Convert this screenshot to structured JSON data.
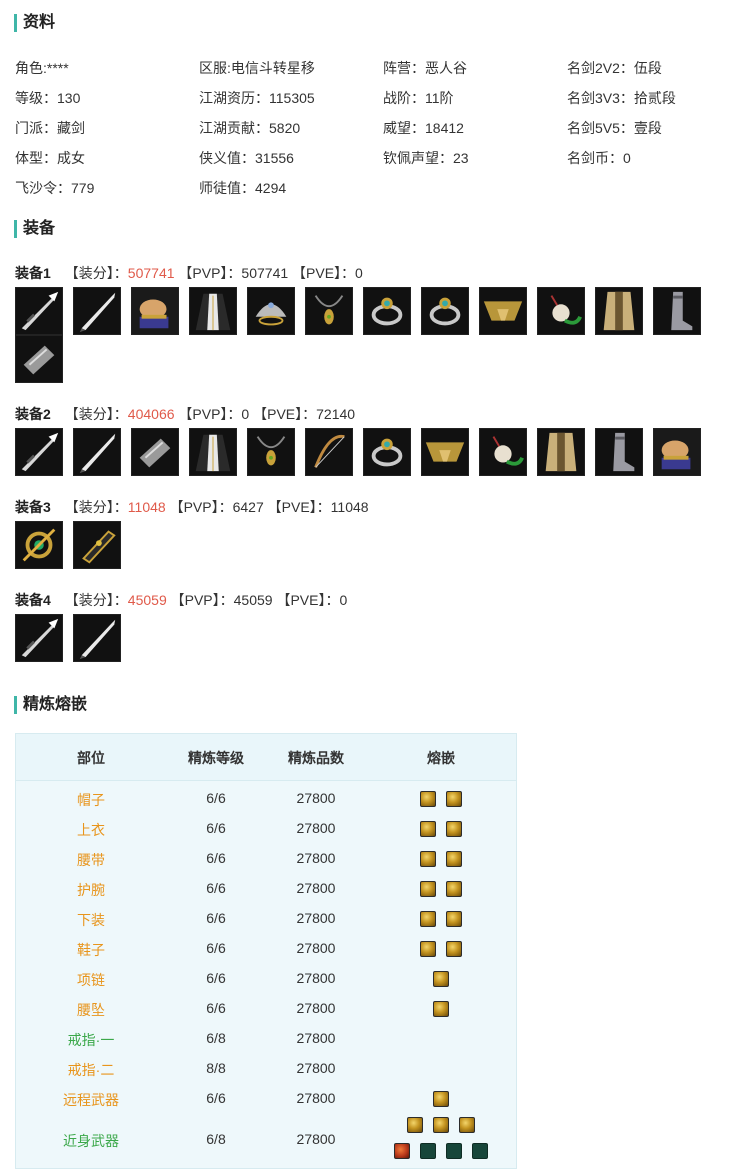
{
  "sections": {
    "profile": "资料",
    "equipment": "装备",
    "refine": "精炼熔嵌"
  },
  "profile": {
    "col1": [
      "角色:****",
      "等级：130",
      "门派：藏剑",
      "体型：成女",
      "飞沙令：779"
    ],
    "col2": [
      "区服:电信斗转星移",
      "江湖资历：115305",
      "江湖贡献：5820",
      "侠义值：31556",
      "师徒值：4294"
    ],
    "col3": [
      "阵营：恶人谷",
      "战阶：11阶",
      "威望：18412",
      "钦佩声望：23"
    ],
    "col4": [
      "名剑2V2：伍段",
      "名剑3V3：拾贰段",
      "名剑5V5：壹段",
      "名剑币：0"
    ]
  },
  "equipment_sets": [
    {
      "name": "装备1",
      "score_label": "【装分】：",
      "score": "507741",
      "pvp_label": "【PVP】：",
      "pvp": "507741",
      "pve_label": "【PVE】：",
      "pve": "0",
      "icons": [
        "spear-icon",
        "sword-icon",
        "glove-icon",
        "robe-icon",
        "helmet-icon",
        "necklace-icon",
        "ring-icon",
        "ring-icon",
        "belt-icon",
        "pendant-icon",
        "coat-icon",
        "boot-icon",
        "bracer-icon"
      ]
    },
    {
      "name": "装备2",
      "score_label": "【装分】：",
      "score": "404066",
      "pvp_label": "【PVP】：",
      "pvp": "0",
      "pve_label": "【PVE】：",
      "pve": "72140",
      "icons": [
        "spear-icon",
        "sword-icon",
        "bracer-icon",
        "robe-icon",
        "necklace-icon",
        "bow-icon",
        "ring-icon",
        "belt-icon",
        "pendant-icon",
        "coat-icon",
        "boot-icon",
        "glove-icon"
      ]
    },
    {
      "name": "装备3",
      "score_label": "【装分】：",
      "score": "11048",
      "pvp_label": "【PVP】：",
      "pvp": "6427",
      "pve_label": "【PVE】：",
      "pve": "11048",
      "icons": [
        "amulet-icon",
        "weapon-icon"
      ]
    },
    {
      "name": "装备4",
      "score_label": "【装分】：",
      "score": "45059",
      "pvp_label": "【PVP】：",
      "pvp": "45059",
      "pve_label": "【PVE】：",
      "pve": "0",
      "icons": [
        "spear-icon",
        "sword-icon"
      ]
    }
  ],
  "refine_table": {
    "headers": [
      "部位",
      "精炼等级",
      "精炼品数",
      "熔嵌"
    ],
    "rows": [
      {
        "part": "帽子",
        "color": "orange",
        "level": "6/6",
        "count": "27800",
        "gems": [
          [
            "gold",
            "gold"
          ]
        ]
      },
      {
        "part": "上衣",
        "color": "orange",
        "level": "6/6",
        "count": "27800",
        "gems": [
          [
            "gold",
            "gold"
          ]
        ]
      },
      {
        "part": "腰带",
        "color": "orange",
        "level": "6/6",
        "count": "27800",
        "gems": [
          [
            "gold",
            "gold"
          ]
        ]
      },
      {
        "part": "护腕",
        "color": "orange",
        "level": "6/6",
        "count": "27800",
        "gems": [
          [
            "gold",
            "gold"
          ]
        ]
      },
      {
        "part": "下装",
        "color": "orange",
        "level": "6/6",
        "count": "27800",
        "gems": [
          [
            "gold",
            "gold"
          ]
        ]
      },
      {
        "part": "鞋子",
        "color": "orange",
        "level": "6/6",
        "count": "27800",
        "gems": [
          [
            "gold",
            "gold"
          ]
        ]
      },
      {
        "part": "项链",
        "color": "orange",
        "level": "6/6",
        "count": "27800",
        "gems": [
          [
            "gold"
          ]
        ]
      },
      {
        "part": "腰坠",
        "color": "orange",
        "level": "6/6",
        "count": "27800",
        "gems": [
          [
            "gold"
          ]
        ]
      },
      {
        "part": "戒指·一",
        "color": "green",
        "level": "6/8",
        "count": "27800",
        "gems": []
      },
      {
        "part": "戒指·二",
        "color": "orange",
        "level": "8/8",
        "count": "27800",
        "gems": []
      },
      {
        "part": "远程武器",
        "color": "orange",
        "level": "6/6",
        "count": "27800",
        "gems": [
          [
            "gold"
          ]
        ]
      },
      {
        "part": "近身武器",
        "color": "green",
        "level": "6/8",
        "count": "27800",
        "gems": [
          [
            "gold",
            "gold",
            "gold"
          ],
          [
            "red",
            "green",
            "green",
            "green"
          ]
        ]
      }
    ]
  }
}
